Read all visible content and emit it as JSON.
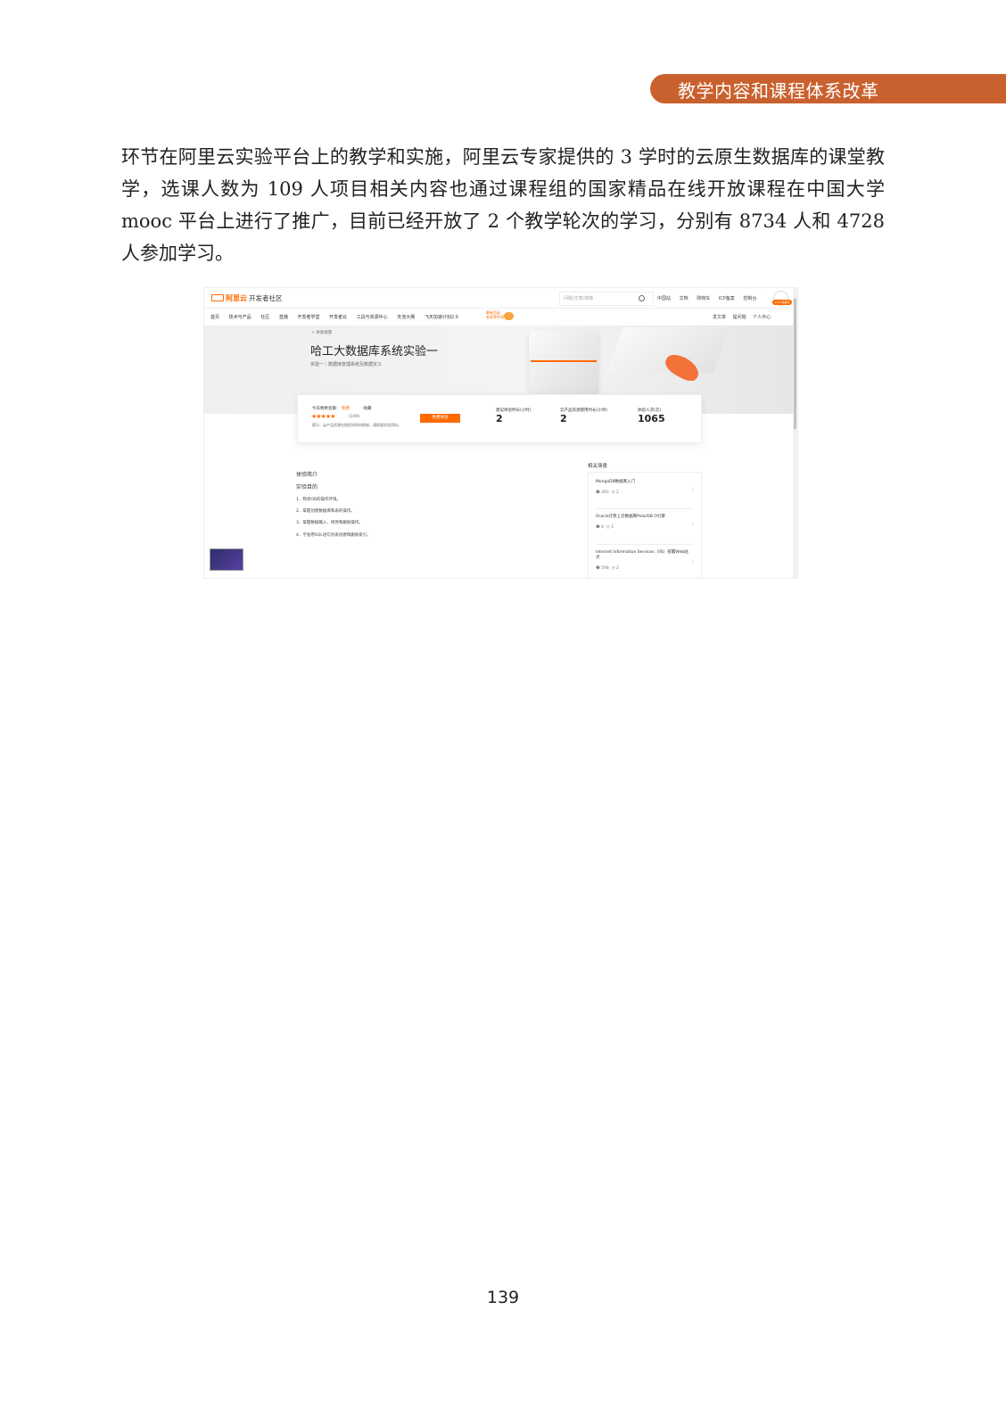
{
  "header": {
    "section_title": "教学内容和课程体系改革"
  },
  "body": {
    "paragraph": "环节在阿里云实验平台上的教学和实施，阿里云专家提供的 3 学时的云原生数据库的课堂教学，选课人数为 109 人项目相关内容也通过课程组的国家精品在线开放课程在中国大学 mooc 平台上进行了推广，目前已经开放了 2 个教学轮次的学习，分别有 8734 人和 4728 人参加学习。"
  },
  "screenshot": {
    "logo": "阿里云",
    "community": "开发者社区",
    "search_placeholder": "问题/文章/镜像",
    "top_nav": [
      "中国站",
      "文档",
      "购物车",
      "ICP备案",
      "控制台"
    ],
    "avatar_badge": "2023领福利",
    "nav": [
      "首页",
      "技术与产品",
      "社区",
      "直播",
      "开发者学堂",
      "开发者云",
      "工具与资源中心",
      "天池大赛",
      "飞天加速计划2.0"
    ],
    "promo": [
      "最新活动",
      "有奖等你领"
    ],
    "right_nav": [
      "发文章",
      "提问题",
      "个人中心"
    ],
    "breadcrumb": "< 体验场景",
    "title": "哈工大数据库系统实验一",
    "subtitle": "实验一｜数据库管理系统及数据定义",
    "card": {
      "free_label": "今天剩余名额：",
      "free_tag": "免费",
      "collect": "收藏",
      "stars": "★★★★★",
      "rating_count": "(109)",
      "tip": "提示：云产品资源在指定时间内释放，请保留实验资料。",
      "button": "免费体验",
      "stats": [
        {
          "label": "建议体验时长(小时)",
          "value": "2"
        },
        {
          "label": "云产品资源使用时长(小时)",
          "value": "2"
        },
        {
          "label": "体验人次(次)",
          "value": "1065"
        }
      ]
    },
    "section_title": "体验简介",
    "section_sub": "实验目的",
    "goals": [
      "1．熟悉OB的操作环境。",
      "2．掌握创建数据库和表的操作。",
      "3．掌握数据输入、修改和删除操作。",
      "4．学会用SQL语句对表创建和删除索引。"
    ],
    "related_title": "相关场景",
    "related": [
      {
        "title": "MongoDB数据库入门",
        "users": "293",
        "time": "2"
      },
      {
        "title": "Oracle迁移上云数据库PolarDB O引擎",
        "users": "6",
        "time": "1"
      },
      {
        "title": "Internet Information Services（IIS）部署Web站点",
        "users": "598",
        "time": "2"
      }
    ]
  },
  "footer": {
    "page_number": "139"
  },
  "colors": {
    "banner": "#c9612f",
    "accent": "#ff6a00"
  }
}
